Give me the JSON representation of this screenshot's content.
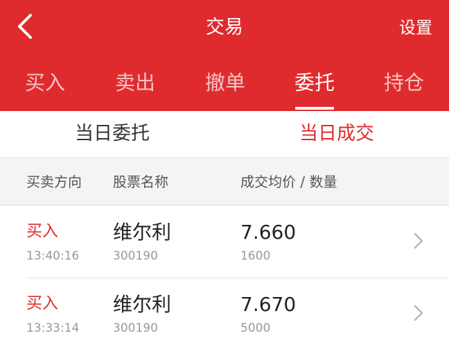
{
  "header": {
    "title": "交易",
    "settings_label": "设置",
    "back_icon": "chevron-left-icon",
    "background_color": "#df2b2e"
  },
  "tabs": [
    {
      "label": "买入",
      "active": false
    },
    {
      "label": "卖出",
      "active": false
    },
    {
      "label": "撤单",
      "active": false
    },
    {
      "label": "委托",
      "active": true
    },
    {
      "label": "持仓",
      "active": false
    }
  ],
  "subtabs": [
    {
      "label": "当日委托",
      "active": false
    },
    {
      "label": "当日成交",
      "active": true
    }
  ],
  "columns": {
    "direction": "买卖方向",
    "stock_name": "股票名称",
    "price_qty": "成交均价 / 数量"
  },
  "trades": [
    {
      "direction": "买入",
      "time": "13:40:16",
      "name": "维尔利",
      "code": "300190",
      "price": "7.660",
      "quantity": "1600"
    },
    {
      "direction": "买入",
      "time": "13:33:14",
      "name": "维尔利",
      "code": "300190",
      "price": "7.670",
      "quantity": "5000"
    }
  ],
  "colors": {
    "accent": "#df2b2e",
    "secondary_text": "#999999"
  }
}
